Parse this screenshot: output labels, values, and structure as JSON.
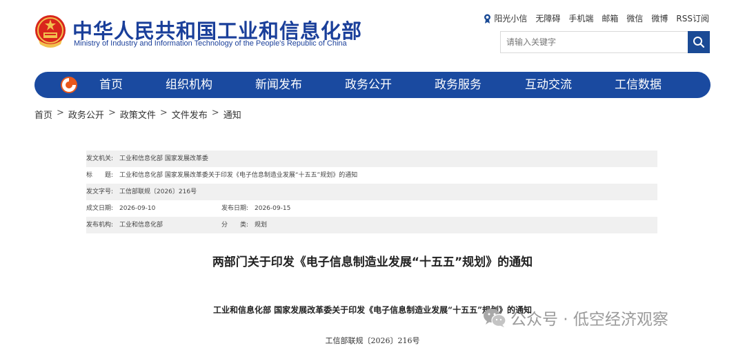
{
  "header": {
    "site_name_cn": "中华人民共和国工业和信息化部",
    "site_name_en": "Ministry of Industry and Information Technology of the People's Republic of China",
    "top_links": [
      "阳光小信",
      "无障碍",
      "手机端",
      "邮箱",
      "微信",
      "微博",
      "RSS订阅"
    ],
    "search_placeholder": "请输入关键字",
    "brand_color": "#1a3f9a"
  },
  "nav": {
    "items": [
      "首页",
      "组织机构",
      "新闻发布",
      "政务公开",
      "政务服务",
      "互动交流",
      "工信数据"
    ],
    "bg_color": "#1a4aa0"
  },
  "breadcrumb": [
    "首页",
    "政务公开",
    "政策文件",
    "文件发布",
    "通知"
  ],
  "meta": {
    "issuer_label": "发文机关:",
    "issuer": "工业和信息化部 国家发展改革委",
    "title_label": "标　　题:",
    "title": "工业和信息化部 国家发展改革委关于印发《电子信息制造业发展“十五五”规划》的通知",
    "doc_no_label": "发文字号:",
    "doc_no": "工信部联规〔2026〕216号",
    "created_label": "成文日期:",
    "created": "2026-09-10",
    "published_label": "发布日期:",
    "published": "2026-09-15",
    "publisher_label": "发布机构:",
    "publisher": "工业和信息化部",
    "category_label": "分　　类:",
    "category": "规划"
  },
  "document": {
    "title": "两部门关于印发《电子信息制造业发展“十五五”规划》的通知",
    "subtitle": "工业和信息化部 国家发展改革委关于印发《电子信息制造业发展“十五五”规划》的通知",
    "doc_number": "工信部联规〔2026〕216号"
  },
  "watermark": {
    "text": "公众号 · 低空经济观察",
    "icon": "wechat-icon"
  }
}
